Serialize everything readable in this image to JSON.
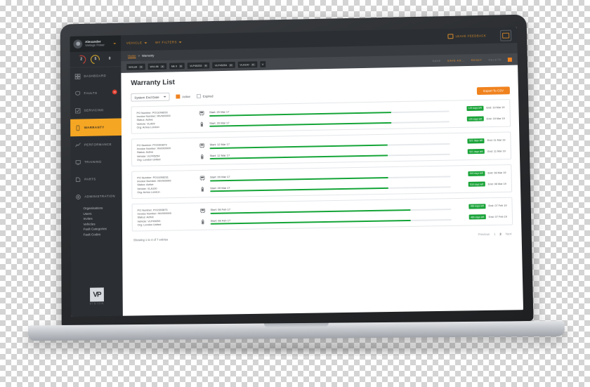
{
  "app": {
    "brand": {
      "user_name": "Alexander",
      "company": "Vantage Power"
    },
    "counters": [
      {
        "name": "faults-critical",
        "value": "2",
        "color": "#d9463c"
      },
      {
        "name": "faults-warning",
        "value": "5",
        "color": "#e8b52a"
      },
      {
        "name": "faults-none",
        "value": "0",
        "color": "#6b7075"
      }
    ],
    "topbar": {
      "menus": [
        {
          "label": "VEHICLE",
          "icon": "chevron-down-icon"
        },
        {
          "label": "MY FILTERS",
          "icon": "chevron-down-icon"
        }
      ],
      "feedback_label": "LEAVE FEEDBACK",
      "feedback_icon": "feedback-icon",
      "corner_icon": "panel-icon"
    },
    "breadcrumb": {
      "home": "Home",
      "separator": ">",
      "current": "Warranty"
    },
    "filter_chips": [
      {
        "label": "WVL84",
        "remove_icon": "close-icon"
      },
      {
        "label": "WVL95",
        "remove_icon": "close-icon"
      },
      {
        "label": "Mk II",
        "remove_icon": "close-icon"
      },
      {
        "label": "VLP45253",
        "remove_icon": "close-icon"
      },
      {
        "label": "VLP45254",
        "remove_icon": "close-icon"
      },
      {
        "label": "VLA100",
        "remove_icon": "close-icon"
      },
      {
        "label": "V",
        "remove_icon": "close-icon"
      }
    ],
    "chip_actions": [
      {
        "label": "SAVE",
        "state": "disabled"
      },
      {
        "label": "SAVE AS...",
        "state": "enabled"
      },
      {
        "label": "RESET",
        "state": "enabled"
      },
      {
        "label": "DELETE",
        "state": "disabled"
      }
    ],
    "flag_icon": "flag-icon"
  },
  "sidebar": {
    "items": [
      {
        "label": "DASHBOARD",
        "icon": "dashboard-icon",
        "active": false,
        "badge": ""
      },
      {
        "label": "FAULTS",
        "icon": "fault-icon",
        "active": false,
        "badge": "70"
      },
      {
        "label": "SERVICING",
        "icon": "servicing-icon",
        "active": false,
        "badge": ""
      },
      {
        "label": "WARRANTY",
        "icon": "warranty-icon",
        "active": true,
        "badge": ""
      },
      {
        "label": "PERFORMANCE",
        "icon": "performance-icon",
        "active": false,
        "badge": ""
      },
      {
        "label": "TRAINING",
        "icon": "training-icon",
        "active": false,
        "badge": ""
      },
      {
        "label": "PARTS",
        "icon": "parts-icon",
        "active": false,
        "badge": ""
      },
      {
        "label": "ADMINISTRATION",
        "icon": "administration-icon",
        "active": false,
        "badge": ""
      }
    ],
    "subitems": [
      "Organisations",
      "Users",
      "Invites",
      "Vehicles",
      "Fault Categories",
      "Fault Codes"
    ],
    "logo": {
      "mark": "VP",
      "word": "VISION"
    }
  },
  "page": {
    "title": "Warranty List",
    "sort_select": {
      "value": "System End Date",
      "icon": "chevron-down-icon"
    },
    "checkboxes": [
      {
        "label": "Active",
        "checked": true
      },
      {
        "label": "Expired",
        "checked": false
      }
    ],
    "export_button": "Export To CSV",
    "cards": [
      {
        "po_number": "PO Number: PO11098231",
        "invoice_number": "Invoice Number: INV000000",
        "status": "Status: Active",
        "vehicle": "Vehicle: VLA09",
        "org": "Org: Arriva London",
        "rows": [
          {
            "icon": "bus-icon",
            "start": "Start: 20 Mar 17",
            "progress": 76,
            "days_left": "129 days left",
            "end": "End: 19 Mar 19"
          },
          {
            "icon": "battery-icon",
            "start": "Start: 20 Mar 17",
            "progress": 76,
            "days_left": "129 days left",
            "end": "End: 19 Mar 19"
          }
        ]
      },
      {
        "po_number": "PO Number: PO2393873",
        "invoice_number": "Invoice Number: INV000000",
        "status": "Status: Active",
        "vehicle": "Vehicle: VLP45254",
        "org": "Org: London United",
        "rows": [
          {
            "icon": "bus-icon",
            "start": "Start: 12 Mar 17",
            "progress": 74,
            "days_left": "521 days left",
            "end": "End: 11 Mar 19"
          },
          {
            "icon": "battery-icon",
            "start": "Start: 12 Mar 17",
            "progress": 74,
            "days_left": "521 days left",
            "end": "End: 11 Mar 19"
          }
        ]
      },
      {
        "po_number": "PO Number: PO11098231",
        "invoice_number": "Invoice Number: INV000000",
        "status": "Status: Active",
        "vehicle": "Vehicle: VLA100",
        "org": "Org: Arriva London",
        "rows": [
          {
            "icon": "bus-icon",
            "start": "Start: 09 Mar 17",
            "progress": 74,
            "days_left": "518 days left",
            "end": "End: 08 Mar 19"
          },
          {
            "icon": "battery-icon",
            "start": "Start: 09 Mar 17",
            "progress": 74,
            "days_left": "518 days left",
            "end": "End: 08 Mar 19"
          }
        ]
      },
      {
        "po_number": "PO Number: PO2393873",
        "invoice_number": "Invoice Number: INV000000",
        "status": "Status: Active",
        "vehicle": "Vehicle: VLP45253",
        "org": "Org: London United",
        "rows": [
          {
            "icon": "bus-icon",
            "start": "Start: 08 Feb 17",
            "progress": 83,
            "days_left": "489 days left",
            "end": "End: 07 Feb 19"
          },
          {
            "icon": "battery-icon",
            "start": "Start: 08 Feb 17",
            "progress": 83,
            "days_left": "489 days left",
            "end": "End: 07 Feb 19"
          }
        ]
      }
    ],
    "footer": {
      "showing": "Showing 1 to 4 of 7 entries",
      "previous": "Previous",
      "pages": [
        "1",
        "2"
      ],
      "current_page": "2",
      "next": "Next"
    }
  },
  "colors": {
    "accent_orange": "#f0821e",
    "sidebar_dark": "#2b2f33",
    "active_yellow": "#f5a623",
    "progress_green": "#13a436",
    "badge_green": "#19a338",
    "alert_red": "#e0392b"
  }
}
